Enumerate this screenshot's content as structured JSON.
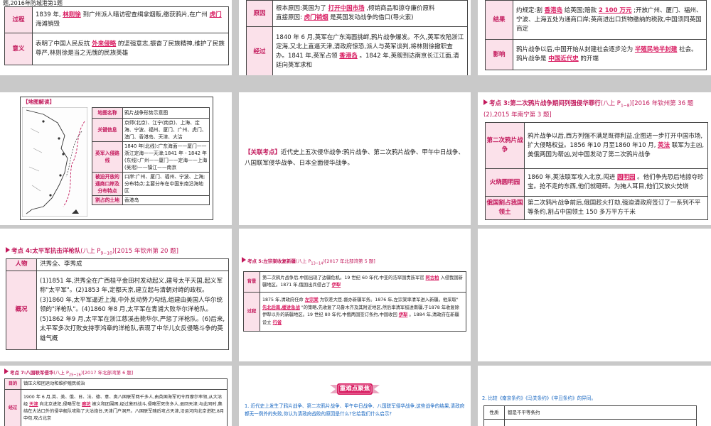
{
  "s1": {
    "top": "题,2016年防城港第1题",
    "rows": [
      {
        "label": "过程",
        "parts": [
          "1839 年, ",
          "林则徐",
          " 到广州派人暗访密查缉拿烟贩,缴获鸦片,在广州 ",
          "虎门",
          " 海滩销毁"
        ]
      },
      {
        "label": "意义",
        "parts": [
          "表明了中国人民反抗 ",
          "外来侵略",
          " 的坚强意志,振奋了民族精神,维护了民族尊严,林则徐是当之无愧的民族英雄"
        ]
      }
    ]
  },
  "s2": {
    "rows": [
      {
        "label": "原因",
        "parts": [
          "根本原因:英国为了 ",
          "打开中国市场",
          " ,倾销商品和掠夺廉价原料",
          "直接原因: ",
          "虎门销烟",
          " 是英国发动战争的借口(导火索)"
        ]
      },
      {
        "label": "经过",
        "parts": [
          "1840 年 6 月,英军在广东海面挑衅,鸦片战争爆发。不久,英军攻陷浙江定海,又北上直逼天津,清政府惊恐,派人与英军谈判,将林则徐撤职查办。1841 年,英军占领 ",
          "香港岛",
          " 。1842 年,英舰到达南京长江江面,清廷向英军求和"
        ]
      }
    ]
  },
  "s3": {
    "rows": [
      {
        "label": "结果",
        "parts": [
          "约规定:割 ",
          "香港岛",
          " 给英国;赔款 ",
          "2 100 万元",
          " ;开放广州、厦门、福州、宁波、上海五处为通商口岸;英商进出口货物缴纳的税款,中国须同英国商定"
        ]
      },
      {
        "label": "影响",
        "parts": [
          "鸦片战争以后,中国开始从封建社会逐步沦为 ",
          "半殖民地半封建",
          " 社会。鸦片战争是 ",
          "中国近代史",
          " 的开端"
        ]
      }
    ]
  },
  "s4": {
    "header": "【地图解读】",
    "rows": [
      {
        "label": "地图名称",
        "value": "鸦片战争形势示意图"
      },
      {
        "label": "关键信息",
        "value": "京师(北京)、江宁(南京)、上海、定海、宁波、福州、厦门、广州、虎门、澳门、香港岛、天津、大沽"
      },
      {
        "label": "英军入侵路线",
        "value": "1840 年(北线):广东海面——厦门——浙江定海——天津;1841 年 - 1842 年(东线):广州——厦门——定海——上海(吴淞)——镇江——南京"
      },
      {
        "label": "被迫开放的通商口岸及分布特点",
        "value": "口岸:广州、厦门、福州、宁波、上海;分布特点:主要分布在中国东南沿海地区"
      },
      {
        "label": "割占的土地",
        "value": "香港岛"
      }
    ]
  },
  "s5": {
    "label": "【关联考点】",
    "text": "近代史上五次侵华战争:鸦片战争、第二次鸦片战争、甲午中日战争、八国联军侵华战争、日本全面侵华战争。"
  },
  "s6": {
    "heading": "考点 3:第二次鸦片战争期间列强侵华罪行",
    "source": "(八上 P",
    "source_sub": "1~8",
    "source_end": ")",
    "ref": "[2016 年钦州第 36 题(2),2015 年南宁第 3 题]",
    "rows": [
      {
        "label": "第二次鸦片战争",
        "parts": [
          "鸦片战争以后,西方列强不满足既得利益,企图进一步打开中国市场,扩大侵略权益。1856 年10 月至1860 年10 月, ",
          "英法",
          " 联军为主凶,美俄两国为帮凶,对中国发动了第二次鸦片战争"
        ]
      },
      {
        "label": "火烧圆明园",
        "parts": [
          "1860 年,英法联军攻入北京,闯进 ",
          "圆明园",
          " 。他们争先恐后地掠夺珍宝。抢不走的东西,他们就砸碎。为掩人耳目,他们又放火焚烧"
        ]
      },
      {
        "label": "俄国割占我国领土",
        "parts": [
          "第二次鸦片战争前后,俄国趁火打劫,强迫清政府签订了一系列不平等条约,割占中国领土 150 多万平方千米"
        ]
      }
    ]
  },
  "s7": {
    "heading": "考点 4:太平军抗击洋枪队",
    "source": "(八上 P",
    "source_sub": "9~10",
    "source_end": ")",
    "ref": "[2015 年钦州第 20 题]",
    "rows": [
      {
        "label": "人物",
        "value": "洪秀全、李秀成"
      },
      {
        "label": "概况",
        "value": "(1)1851 年,洪秀全在广西桂平金田村发动起义,建号太平天国,起义军称\"太平军\"。(2)1853 年,定都天京,建立起与清朝对峙的政权。(3)1860 年,太平军逼近上海,中外反动势力勾结,组建由美国人华尔统领的\"洋枪队\"。(4)1860 年8 月,太平军在青浦大败华尔洋枪队。(5)1862 年9 月,太平军在浙江慈溪击毙华尔,严惩了洋枪队。(6)后来,太平军多次打败支持李鸿章的洋枪队,表现了中华儿女反侵略斗争的英雄气概"
      }
    ]
  },
  "s8": {
    "heading": "考点 5:左宗棠收复新疆",
    "source": "(八上 P",
    "source_sub": "13~14",
    "source_end": ")",
    "ref": "[2017 年北部湾第 5 题]",
    "rows": [
      {
        "label": "背景",
        "parts": [
          "第二次鸦片战争后,中国出现了边疆危机。19 世纪 60 年代,中亚的浩罕国贵族军官 ",
          "阿古柏",
          " 入侵我国新疆地区。1871 年,俄国出兵侵占了 ",
          "伊犁"
        ]
      },
      {
        "label": "过程",
        "parts": [
          "1875 年,清政府任命 ",
          "左宗棠",
          " 为钦差大臣,督办新疆军务。1876 年,左宗棠率清军进入新疆。他采取\" ",
          "先北后南,缓进急战",
          " \"的策略,先收复了乌鲁木齐及其附近地区,然后率清军挺进南疆,于1878 年收复除伊犁以外的新疆地区。19 世纪 80 年代,中俄两国签订条约,中国收回 ",
          "伊犁",
          " 。1884 年,清政府在新疆设立 ",
          "行省"
        ]
      }
    ]
  },
  "s9": {},
  "s10": {
    "heading": "考点 7:八国联军侵华",
    "source": "(八上 P",
    "source_sub": "25~26",
    "source_end": ")",
    "ref": "[2017 年北部湾第 6 题]",
    "rows": [
      {
        "label": "目的",
        "parts": [
          "镇压义和团运动和维护殖民统治"
        ]
      },
      {
        "label": "经过",
        "parts": [
          "1900 年 6 月,英、美、俄、日、法、德、意、奥八国联军两千多人,由英国海军司令西摩尔率领,从大沽经 ",
          "天津",
          " 向北京进犯,侵略军在 ",
          "廊坊",
          " 被义和团围困,经过激烈战斗,侵略军死伤多人,退回天津;与此同时,集结在大沽口外的侵华舰队攻陷了大沽炮台,天津门户洞开。八国联军随后攻占天津,沿运河向北京进犯,8月中旬,攻占北京"
        ]
      }
    ]
  },
  "s11": {
    "banner": "重难点聚焦",
    "question": "1. 近代史上发生了鸦片战争、第二次鸦片战争、甲午中日战争、八国联军侵华战争,这些战争的结果,清政府都无一例外的失败,你认为清政府战败的原因是什么?它给我们什么启示?"
  },
  "s12": {
    "question": "2. 比较《南京条约》《马关条约》《辛丑条约》的异同。",
    "rows": [
      {
        "label": "性质",
        "value": "都是不平等条约"
      }
    ]
  }
}
